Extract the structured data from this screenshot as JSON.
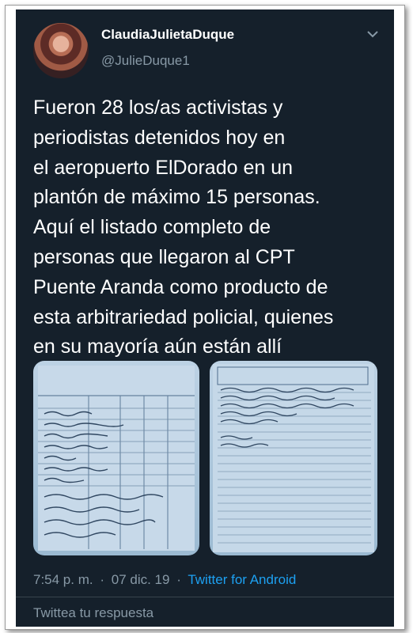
{
  "user": {
    "name": "ClaudiaJulietaDuque",
    "handle": "@JulieDuque1"
  },
  "tweet": {
    "text": "Fueron 28 los/as activistas y\nperiodistas detenidos hoy en\nel aeropuerto ElDorado en un\nplantón de máximo 15 personas.\nAquí el listado completo de\npersonas que llegaron al CPT\nPuente Aranda como producto de\nesta arbitrariedad policial, quienes\nen su mayoría aún están allí",
    "time": "7:54 p. m.",
    "date": "07 dic. 19",
    "separator": "·",
    "source": "Twitter for Android"
  },
  "photos": [
    {
      "description": "handwritten detainee list (left document)"
    },
    {
      "description": "handwritten meeting record sheet (right document)"
    }
  ],
  "reply": {
    "placeholder": "Twittea tu respuesta"
  },
  "colors": {
    "background": "#15202b",
    "text": "#ffffff",
    "muted": "#8899a6",
    "link": "#1da1f2"
  },
  "icons": [
    "chevron-down-icon"
  ]
}
